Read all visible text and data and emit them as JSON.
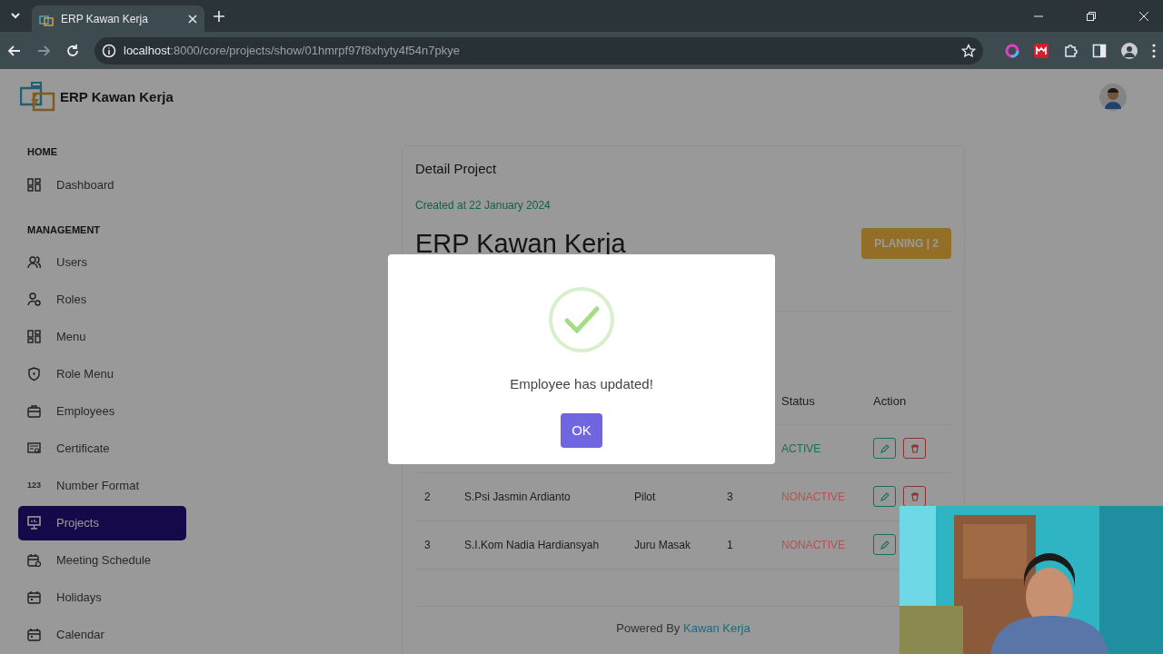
{
  "browser": {
    "tab_title": "ERP Kawan Kerja",
    "url_host": "localhost",
    "url_path": ":8000/core/projects/show/01hmrpf97f8xhyty4f54n7pkye"
  },
  "app": {
    "brand": "ERP Kawan Kerja"
  },
  "sidebar": {
    "sections": [
      {
        "title": "HOME",
        "items": [
          {
            "label": "Dashboard",
            "kind": "dashboard",
            "selected": false
          }
        ]
      },
      {
        "title": "MANAGEMENT",
        "items": [
          {
            "label": "Users",
            "kind": "users",
            "selected": false
          },
          {
            "label": "Roles",
            "kind": "roles",
            "selected": false
          },
          {
            "label": "Menu",
            "kind": "dashboard",
            "selected": false
          },
          {
            "label": "Role Menu",
            "kind": "shield",
            "selected": false
          },
          {
            "label": "Employees",
            "kind": "briefcase",
            "selected": false
          },
          {
            "label": "Certificate",
            "kind": "certificate",
            "selected": false
          },
          {
            "label": "Number Format",
            "kind": "number",
            "icon_text": "123",
            "selected": false
          },
          {
            "label": "Projects",
            "kind": "presentation",
            "selected": true
          },
          {
            "label": "Meeting Schedule",
            "kind": "calendar-clock",
            "selected": false
          },
          {
            "label": "Holidays",
            "kind": "calendar",
            "selected": false
          },
          {
            "label": "Calendar",
            "kind": "calendar",
            "selected": false
          }
        ]
      }
    ]
  },
  "project": {
    "heading": "Detail Project",
    "created": "Created at 22 January 2024",
    "title": "ERP Kawan Kerja",
    "badge": "PLANING | 2"
  },
  "table": {
    "columns": [
      "Status",
      "Action"
    ],
    "rows": [
      {
        "no": "",
        "name": "",
        "position": "",
        "column_4": "",
        "status": {
          "text": "ACTIVE",
          "color": "#17704a"
        },
        "actions": [
          {
            "kind": "edit"
          },
          {
            "kind": "delete"
          }
        ]
      },
      {
        "no": "2",
        "name": "S.Psi Jasmin Ardianto",
        "position": "Pilot",
        "column_4": "3",
        "status": {
          "text": "NONACTIVE",
          "color": "#b8524a"
        },
        "actions": [
          {
            "kind": "edit"
          },
          {
            "kind": "delete"
          }
        ]
      },
      {
        "no": "3",
        "name": "S.I.Kom Nadia Hardiansyah",
        "position": "Juru Masak",
        "column_4": "1",
        "status": {
          "text": "NONACTIVE",
          "color": "#b8524a"
        },
        "actions": [
          {
            "kind": "edit"
          }
        ]
      }
    ]
  },
  "footer": {
    "text": "Powered By",
    "link": "Kawan Kerja"
  },
  "dialog": {
    "kind": "success",
    "message": "Employee has updated!",
    "button": "OK"
  }
}
